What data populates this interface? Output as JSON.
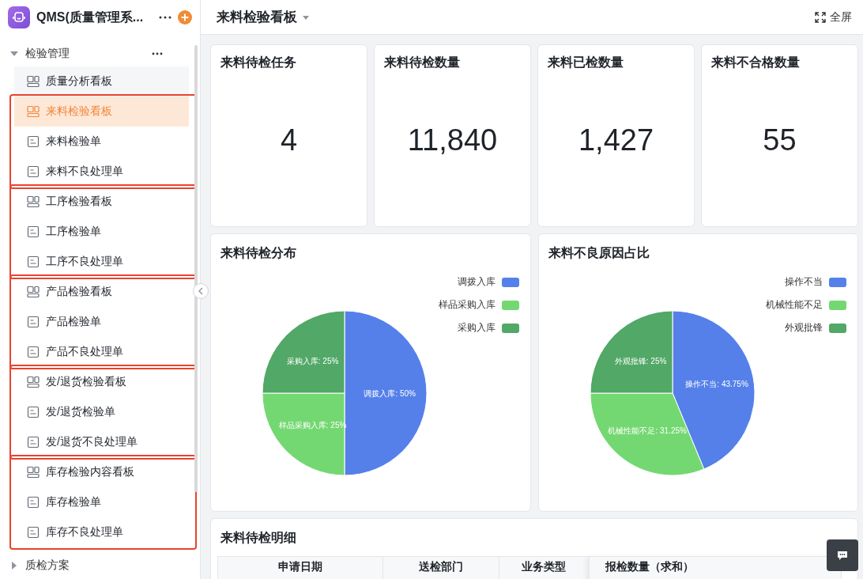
{
  "app": {
    "title": "QMS(质量管理系..."
  },
  "sidebar": {
    "sections": [
      {
        "label": "检验管理",
        "expanded": true,
        "groups": [
          {
            "outlined": false,
            "items": [
              {
                "label": "质量分析看板",
                "kind": "board",
                "selected": false
              }
            ]
          },
          {
            "outlined": true,
            "items": [
              {
                "label": "来料检验看板",
                "kind": "board",
                "selected": true
              },
              {
                "label": "来料检验单",
                "kind": "form",
                "selected": false
              },
              {
                "label": "来料不良处理单",
                "kind": "form",
                "selected": false
              }
            ]
          },
          {
            "outlined": true,
            "items": [
              {
                "label": "工序检验看板",
                "kind": "board",
                "selected": false
              },
              {
                "label": "工序检验单",
                "kind": "form",
                "selected": false
              },
              {
                "label": "工序不良处理单",
                "kind": "form",
                "selected": false
              }
            ]
          },
          {
            "outlined": true,
            "items": [
              {
                "label": "产品检验看板",
                "kind": "board",
                "selected": false
              },
              {
                "label": "产品检验单",
                "kind": "form",
                "selected": false
              },
              {
                "label": "产品不良处理单",
                "kind": "form",
                "selected": false
              }
            ]
          },
          {
            "outlined": true,
            "items": [
              {
                "label": "发/退货检验看板",
                "kind": "board",
                "selected": false
              },
              {
                "label": "发/退货检验单",
                "kind": "form",
                "selected": false
              },
              {
                "label": "发/退货不良处理单",
                "kind": "form",
                "selected": false
              }
            ]
          },
          {
            "outlined": true,
            "items": [
              {
                "label": "库存检验内容看板",
                "kind": "board",
                "selected": false
              },
              {
                "label": "库存检验单",
                "kind": "form",
                "selected": false
              },
              {
                "label": "库存不良处理单",
                "kind": "form",
                "selected": false
              }
            ]
          }
        ]
      },
      {
        "label": "质检方案",
        "expanded": false
      }
    ]
  },
  "header": {
    "title": "来料检验看板",
    "fullscreen": "全屏"
  },
  "stats": [
    {
      "title": "来料待检任务",
      "value": "4"
    },
    {
      "title": "来料待检数量",
      "value": "11,840"
    },
    {
      "title": "来料已检数量",
      "value": "1,427"
    },
    {
      "title": "来料不合格数量",
      "value": "55"
    }
  ],
  "charts": [
    {
      "title": "来料待检分布",
      "chart_data": {
        "type": "pie",
        "categories": [
          "调拨入库",
          "样品采购入库",
          "采购入库"
        ],
        "values": [
          50,
          25,
          25
        ],
        "colors": [
          "#5580ea",
          "#74d872",
          "#52a866"
        ],
        "value_labels": [
          "调拨入库: 50%",
          "样品采购入库: 25%",
          "采购入库: 25%"
        ]
      }
    },
    {
      "title": "来料不良原因占比",
      "chart_data": {
        "type": "pie",
        "categories": [
          "操作不当",
          "机械性能不足",
          "外观批锋"
        ],
        "values": [
          43.75,
          31.25,
          25
        ],
        "colors": [
          "#5580ea",
          "#74d872",
          "#52a866"
        ],
        "value_labels": [
          "操作不当: 43.75%",
          "机械性能不足: 31.25%",
          "外观批锋: 25%"
        ]
      }
    }
  ],
  "detail_table": {
    "title": "来料待检明细",
    "columns": [
      "申请日期",
      "送检部门",
      "业务类型",
      "报检数量（求和）"
    ]
  }
}
